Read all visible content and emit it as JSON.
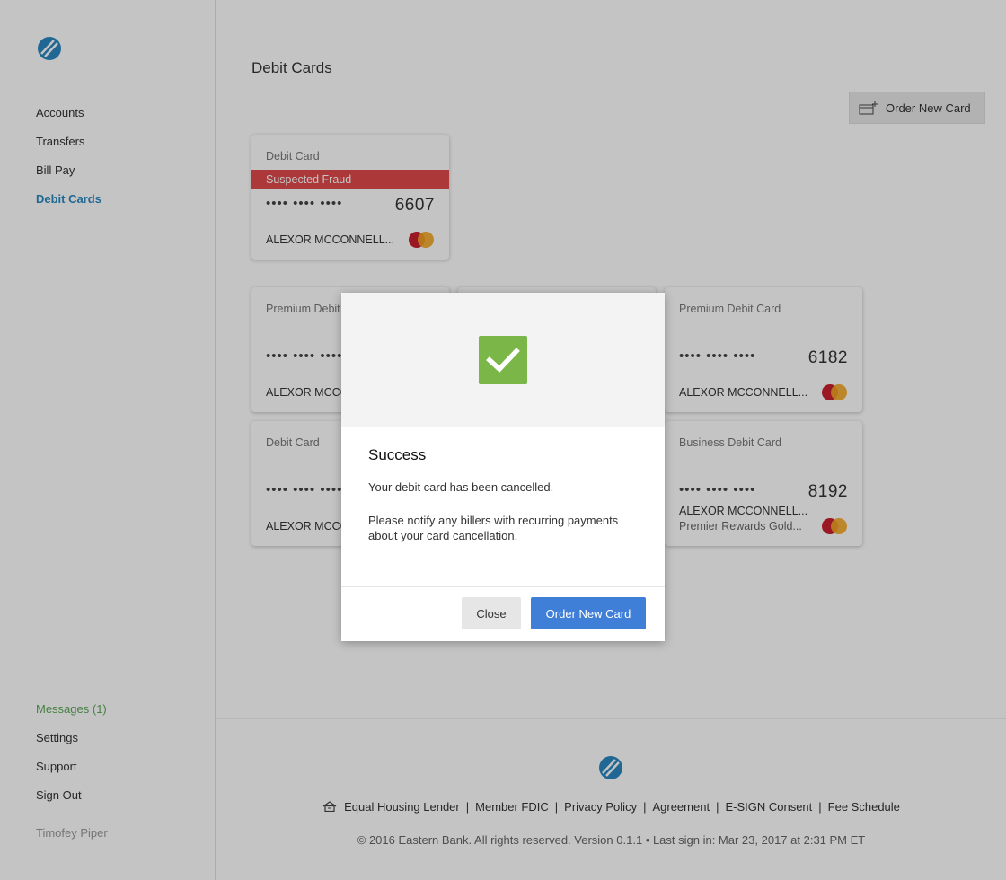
{
  "sidebar": {
    "logo_icon": "bank-logo-icon",
    "nav": [
      "Accounts",
      "Transfers",
      "Bill Pay",
      "Debit Cards"
    ],
    "active": "Debit Cards",
    "bottom": [
      "Messages (1)",
      "Settings",
      "Support",
      "Sign Out"
    ],
    "user": "Timofey Piper"
  },
  "main": {
    "title": "Debit Cards",
    "order_button": "Order New Card",
    "order_icon": "add-card-icon"
  },
  "cards": [
    {
      "type": "Debit Card",
      "status": "Suspected Fraud",
      "dots": "•••• •••• ••••",
      "last4": "6607",
      "holder": "ALEXOR MCCONNELL...",
      "network_icon": "mastercard-icon"
    },
    {
      "type": "Premium Debit Card",
      "dots": "•••• •••• ••••",
      "last4": "",
      "holder": "ALEXOR MCCONNELL...",
      "network_icon": "mastercard-icon"
    },
    {
      "type": "",
      "dots": "•••• •••• ••••",
      "last4": "",
      "holder": "",
      "network_icon": "mastercard-icon"
    },
    {
      "type": "Premium Debit Card",
      "dots": "•••• •••• ••••",
      "last4": "6182",
      "holder": "ALEXOR MCCONNELL...",
      "network_icon": "mastercard-icon"
    },
    {
      "type": "Debit Card",
      "dots": "•••• •••• ••••",
      "last4": "",
      "holder": "ALEXOR MCCONNELL...",
      "network_icon": "mastercard-icon"
    },
    {
      "type": "",
      "dots": "•••• •••• ••••",
      "last4": "",
      "holder": "",
      "network_icon": "mastercard-icon"
    },
    {
      "type": "Business Debit Card",
      "dots": "•••• •••• ••••",
      "last4": "8192",
      "holder": "ALEXOR MCCONNELL...",
      "subtitle": "Premier Rewards Gold...",
      "network_icon": "mastercard-icon"
    }
  ],
  "modal": {
    "icon": "checkmark-icon",
    "title": "Success",
    "message1": "Your debit card has been cancelled.",
    "message2": "Please notify any billers with recurring payments about your card cancellation.",
    "close": "Close",
    "order": "Order New Card"
  },
  "footer": {
    "house_icon": "equal-housing-icon",
    "links": [
      "Equal Housing Lender",
      "Member FDIC",
      "Privacy Policy",
      "Agreement",
      "E-SIGN Consent",
      "Fee Schedule"
    ],
    "separator": "|",
    "copyright": "© 2016 Eastern Bank. All rights reserved. Version 0.1.1 • Last sign in: Mar 23, 2017 at 2:31 PM ET"
  },
  "colors": {
    "accent": "#2a88c0",
    "fraud": "#e0494b",
    "success": "#7ab648",
    "primary_button": "#3f7fd8",
    "messages": "#5aa857"
  }
}
